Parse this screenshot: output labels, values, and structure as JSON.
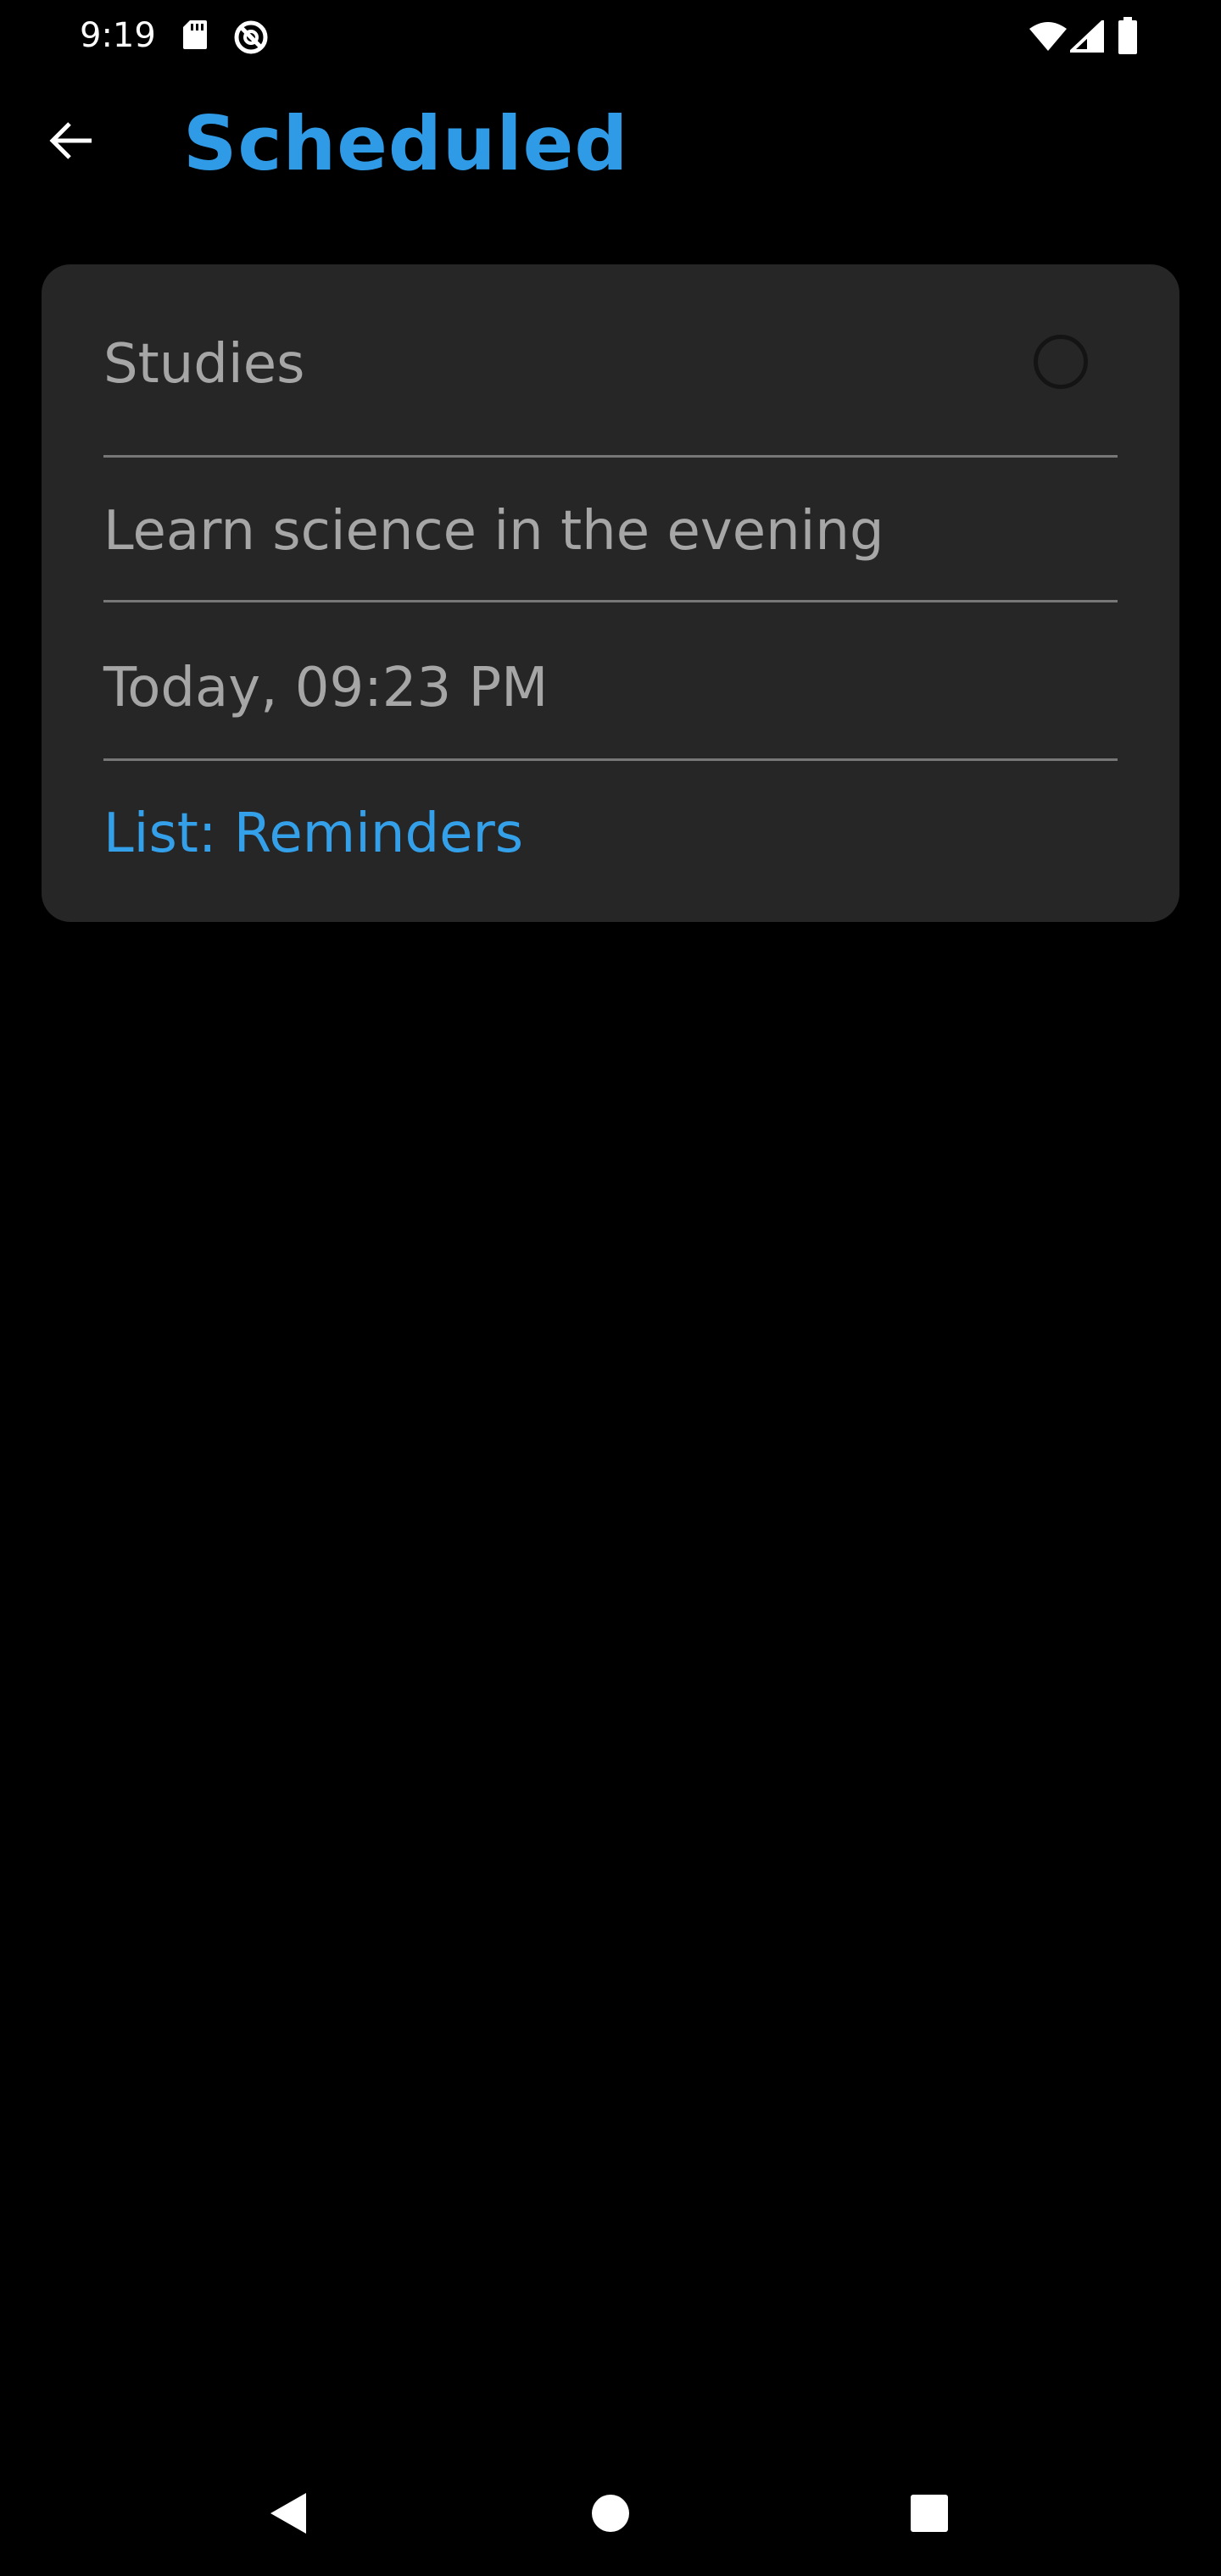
{
  "status_bar": {
    "time": "9:19",
    "left_icons": [
      "sd-card-icon",
      "data-saver-icon"
    ],
    "right_icons": [
      "wifi-icon",
      "signal-icon",
      "battery-icon"
    ]
  },
  "app_bar": {
    "back_icon": "arrow-back-icon",
    "title": "Scheduled",
    "title_color": "#2f9ae6"
  },
  "reminder": {
    "title": "Studies",
    "notes": "Learn science in the evening",
    "due": "Today, 09:23 PM",
    "list_label": "List: Reminders",
    "completed": false,
    "list_color": "#34a0ea"
  },
  "nav_bar": {
    "back_icon": "nav-back-icon",
    "home_icon": "nav-home-icon",
    "recents_icon": "nav-recents-icon"
  }
}
